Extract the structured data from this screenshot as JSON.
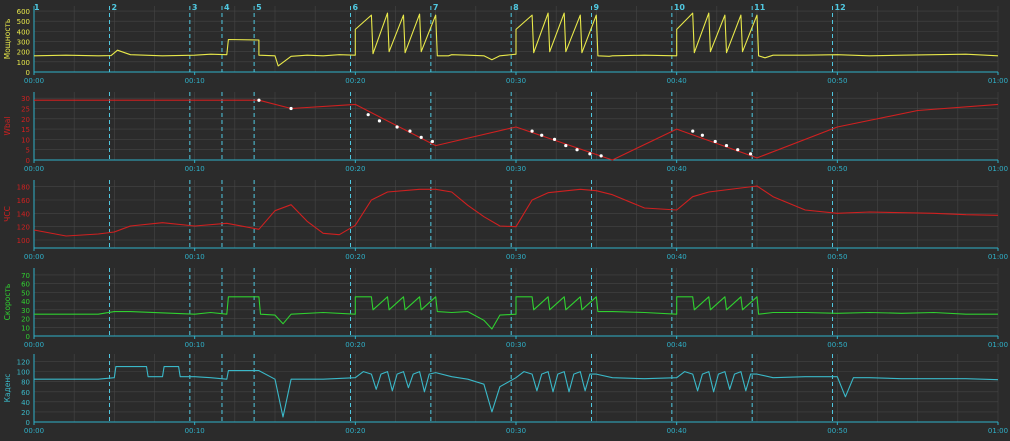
{
  "chart_data": [
    {
      "type": "line",
      "ylabel": "Мощность",
      "color": "#e8e84a",
      "yticks": [
        "0",
        "100",
        "200",
        "300",
        "400",
        "500",
        "600"
      ],
      "ylim": [
        0,
        650
      ],
      "x": [
        0,
        2,
        4,
        4.8,
        5.2,
        6,
        8,
        10,
        11,
        12,
        12.1,
        14,
        14,
        15,
        15.2,
        16,
        17,
        18,
        19,
        20,
        20,
        21,
        21.1,
        22,
        22.1,
        23,
        23.1,
        24,
        24.1,
        25,
        25.1,
        25.8,
        26,
        27,
        28,
        28.5,
        29,
        30,
        30,
        31,
        31.1,
        32,
        32.1,
        33,
        33.1,
        34,
        34.1,
        35,
        35.1,
        35.8,
        36,
        38,
        40,
        40,
        41,
        41.1,
        42,
        42.1,
        43,
        43.1,
        44,
        44.1,
        45,
        45.1,
        45.5,
        46,
        48,
        50,
        52,
        54,
        56,
        58,
        60
      ],
      "values": [
        160,
        165,
        160,
        162,
        215,
        170,
        160,
        165,
        175,
        170,
        320,
        315,
        165,
        160,
        60,
        155,
        165,
        160,
        170,
        165,
        420,
        560,
        180,
        580,
        200,
        560,
        190,
        570,
        200,
        560,
        160,
        160,
        170,
        165,
        160,
        120,
        160,
        175,
        420,
        560,
        190,
        580,
        200,
        580,
        200,
        560,
        190,
        560,
        160,
        155,
        160,
        165,
        160,
        420,
        580,
        190,
        580,
        200,
        560,
        190,
        560,
        200,
        560,
        160,
        140,
        165,
        165,
        170,
        160,
        165,
        170,
        175,
        160
      ],
      "x_tick_labels": [
        "00:00",
        "00:10",
        "00:20",
        "00:30",
        "00:40",
        "00:50",
        "01:00"
      ],
      "x_ticks": [
        0,
        10,
        20,
        30,
        40,
        50,
        60
      ]
    },
    {
      "type": "line",
      "ylabel": "Wbal",
      "color": "#d02020",
      "yticks": [
        "0",
        "5",
        "10",
        "15",
        "20",
        "25",
        "30"
      ],
      "ylim": [
        0,
        33
      ],
      "x": [
        0,
        14,
        16,
        20,
        25,
        30,
        36,
        40,
        45,
        50,
        55,
        60
      ],
      "values": [
        29,
        29,
        25,
        27,
        7,
        16,
        0,
        15,
        1,
        16,
        24,
        27
      ],
      "markers": [
        [
          14,
          29
        ],
        [
          16,
          25
        ],
        [
          20.8,
          22
        ],
        [
          21.5,
          19
        ],
        [
          22.6,
          16
        ],
        [
          23.4,
          14
        ],
        [
          24.1,
          11
        ],
        [
          24.8,
          9
        ],
        [
          31,
          14
        ],
        [
          31.6,
          12
        ],
        [
          32.4,
          10
        ],
        [
          33.1,
          7
        ],
        [
          33.8,
          5
        ],
        [
          34.6,
          3
        ],
        [
          35.3,
          2
        ],
        [
          41,
          14
        ],
        [
          41.6,
          12
        ],
        [
          42.4,
          9
        ],
        [
          43.1,
          7
        ],
        [
          43.8,
          5
        ],
        [
          44.6,
          3
        ]
      ]
    },
    {
      "type": "line",
      "ylabel": "ЧСС",
      "color": "#d02020",
      "yticks": [
        "100",
        "120",
        "140",
        "160",
        "180"
      ],
      "ylim": [
        88,
        190
      ],
      "x": [
        0,
        2,
        4,
        5,
        6,
        8,
        10,
        12,
        14,
        15,
        16,
        17,
        18,
        19,
        20,
        21,
        22,
        24,
        25,
        26,
        27,
        28,
        29,
        30,
        31,
        32,
        34,
        35,
        36,
        38,
        40,
        41,
        42,
        44,
        45,
        46,
        48,
        50,
        52,
        54,
        56,
        58,
        60
      ],
      "values": [
        115,
        106,
        109,
        112,
        121,
        126,
        121,
        125,
        116,
        144,
        153,
        128,
        110,
        108,
        122,
        160,
        172,
        176,
        176,
        172,
        152,
        135,
        121,
        120,
        160,
        171,
        176,
        174,
        168,
        148,
        145,
        165,
        172,
        178,
        181,
        165,
        145,
        140,
        142,
        141,
        140,
        138,
        137
      ]
    },
    {
      "type": "line",
      "ylabel": "Скорость",
      "color": "#30d030",
      "yticks": [
        "0",
        "10",
        "20",
        "30",
        "40",
        "50",
        "60",
        "70"
      ],
      "ylim": [
        0,
        78
      ],
      "x": [
        0,
        4,
        5,
        6,
        10,
        11,
        12,
        12.1,
        14,
        14.1,
        15,
        15.5,
        16,
        18,
        20,
        20,
        21,
        21.1,
        22,
        22.1,
        23,
        23.1,
        24,
        24.1,
        25,
        25.1,
        26,
        27,
        28,
        28.5,
        29,
        30,
        30,
        31,
        31.1,
        32,
        32.1,
        33,
        33.1,
        34,
        34.1,
        35,
        35.1,
        36,
        38,
        40,
        40,
        41,
        41.1,
        42,
        42.1,
        43,
        43.1,
        44,
        44.1,
        45,
        45.1,
        46,
        48,
        50,
        52,
        54,
        56,
        58,
        60
      ],
      "values": [
        25,
        25,
        28,
        28,
        25,
        27,
        25,
        45,
        45,
        25,
        24,
        14,
        25,
        27,
        25,
        45,
        45,
        30,
        45,
        30,
        45,
        30,
        45,
        30,
        45,
        28,
        27,
        28,
        18,
        8,
        24,
        25,
        45,
        45,
        30,
        45,
        30,
        45,
        30,
        45,
        30,
        45,
        28,
        28,
        27,
        25,
        45,
        45,
        30,
        45,
        30,
        45,
        30,
        45,
        30,
        45,
        25,
        27,
        27,
        26,
        27,
        26,
        27,
        25,
        25
      ]
    },
    {
      "type": "line",
      "ylabel": "Каденс",
      "color": "#3ab8c8",
      "yticks": [
        "0",
        "20",
        "40",
        "60",
        "80",
        "100",
        "120"
      ],
      "ylim": [
        0,
        135
      ],
      "x": [
        0,
        4,
        5,
        5.1,
        7,
        7.1,
        8,
        8.1,
        9,
        9.1,
        10,
        11,
        12,
        12.1,
        14,
        15,
        15.5,
        16,
        18,
        20,
        20.5,
        21,
        21.3,
        21.6,
        22,
        22.3,
        22.6,
        23,
        23.3,
        23.6,
        24,
        24.3,
        24.6,
        25,
        26,
        27,
        28,
        28.5,
        29,
        30,
        30.5,
        31,
        31.3,
        31.6,
        32,
        32.3,
        32.6,
        33,
        33.3,
        33.6,
        34,
        34.3,
        34.6,
        35,
        36,
        38,
        40,
        40.5,
        41,
        41.3,
        41.6,
        42,
        42.3,
        42.6,
        43,
        43.3,
        43.6,
        44,
        44.3,
        44.6,
        45,
        46,
        48,
        50,
        50.5,
        51,
        52,
        54,
        56,
        58,
        60
      ],
      "values": [
        85,
        85,
        88,
        110,
        110,
        90,
        90,
        110,
        110,
        90,
        90,
        88,
        85,
        102,
        102,
        85,
        10,
        85,
        85,
        88,
        100,
        95,
        65,
        95,
        100,
        62,
        95,
        100,
        68,
        95,
        100,
        60,
        95,
        98,
        90,
        85,
        75,
        20,
        70,
        88,
        100,
        95,
        62,
        95,
        100,
        60,
        95,
        100,
        60,
        95,
        100,
        62,
        95,
        95,
        88,
        86,
        88,
        100,
        95,
        62,
        95,
        100,
        60,
        95,
        100,
        65,
        95,
        100,
        62,
        95,
        95,
        88,
        90,
        90,
        50,
        88,
        88,
        86,
        86,
        86,
        84
      ]
    }
  ],
  "markers": [
    {
      "label": "1",
      "t": 0
    },
    {
      "label": "2",
      "t": 4.7
    },
    {
      "label": "3",
      "t": 9.7
    },
    {
      "label": "4",
      "t": 11.7
    },
    {
      "label": "5",
      "t": 13.7
    },
    {
      "label": "6",
      "t": 19.7
    },
    {
      "label": "7",
      "t": 24.7
    },
    {
      "label": "8",
      "t": 29.7
    },
    {
      "label": "9",
      "t": 34.7
    },
    {
      "label": "10",
      "t": 39.7
    },
    {
      "label": "11",
      "t": 44.7
    },
    {
      "label": "12",
      "t": 49.7
    }
  ],
  "colors": {
    "background": "#2b2b2b",
    "grid": "#454545",
    "axis": "#2fb0c8",
    "marker_line": "#50c8e0"
  }
}
